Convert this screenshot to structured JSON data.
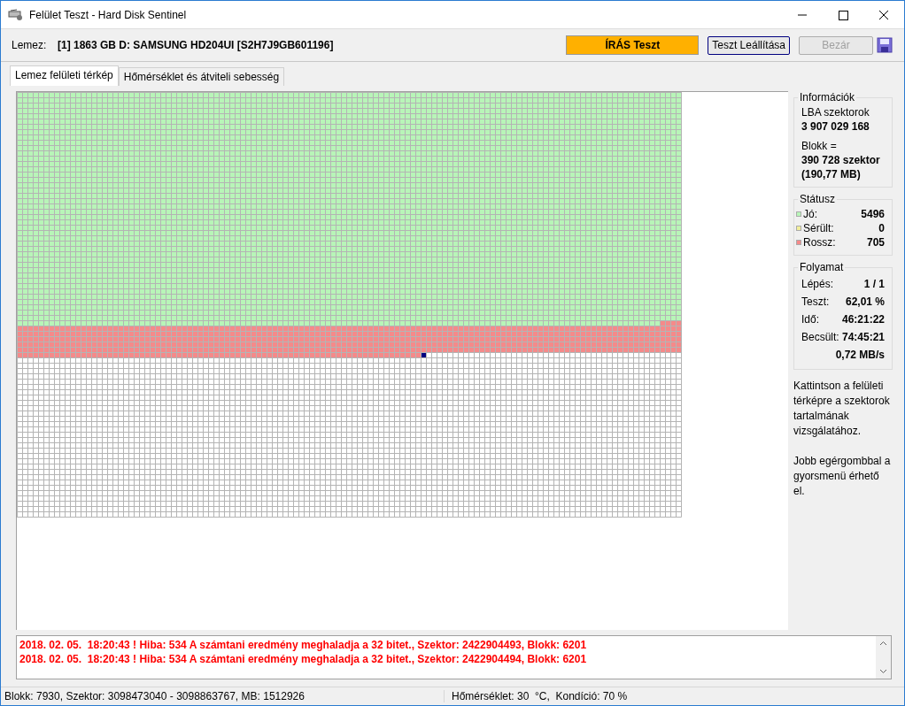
{
  "window": {
    "title": "Felület Teszt - Hard Disk Sentinel"
  },
  "toolbar": {
    "disk_label": "Lemez:",
    "disk": "[1] 1863 GB D: SAMSUNG HD204UI [S2H7J9GB601196]",
    "mode": "ÍRÁS Teszt",
    "buttons": [
      {
        "label": "Teszt Leállítása",
        "disabled": false
      },
      {
        "label": "Bezár",
        "disabled": true
      }
    ]
  },
  "tabs": [
    {
      "label": "Lemez felületi térkép",
      "selected": true
    },
    {
      "label": "Hőmérséklet és átviteli sebesség",
      "selected": false
    }
  ],
  "info": {
    "title": "Információk",
    "lines": [
      {
        "text": "LBA szektorok",
        "bold": false
      },
      {
        "text": "3 907 029 168",
        "bold": true
      },
      {
        "text": "Blokk =",
        "bold": false
      },
      {
        "text": "390 728 szektor",
        "bold": true
      },
      {
        "text": "(190,77 MB)",
        "bold": true
      }
    ]
  },
  "status": {
    "title": "Státusz",
    "items": [
      {
        "label": "Jó:",
        "value": "5496",
        "color": "#b8f5b8"
      },
      {
        "label": "Sérült:",
        "value": "0",
        "color": "#f2ee9a"
      },
      {
        "label": "Rossz:",
        "value": "705",
        "color": "#f58a8a"
      }
    ]
  },
  "progress": {
    "title": "Folyamat",
    "rows": [
      {
        "label": "Lépés:",
        "value": "1 / 1"
      },
      {
        "label": "Teszt:",
        "value": "62,01 %"
      },
      {
        "label": "Idő:",
        "value": "46:21:22"
      },
      {
        "label": "Becsült:",
        "value": "74:45:21"
      },
      {
        "value": "0,72 MB/s"
      }
    ]
  },
  "help": [
    "Kattintson a felületi térképre a szektorok tartalmának vizsgálatához.",
    "Jobb egérgombbal a gyorsmenü érhető el."
  ],
  "log": [
    "2018. 02. 05.  18:20:43 ! Hiba: 534 A számtani eredmény meghaladja a 32 bitet., Szektor: 2422904493, Blokk: 6201",
    "2018. 02. 05.  18:20:43 ! Hiba: 534 A számtani eredmény meghaladja a 32 bitet., Szektor: 2422904494, Blokk: 6201"
  ],
  "status_bar": [
    "Blokk: 7930, Szektor: 3098473040 - 3098863767, MB: 1512926",
    "Hőmérséklet: 30  °C,  Kondíció: 70 %"
  ]
}
